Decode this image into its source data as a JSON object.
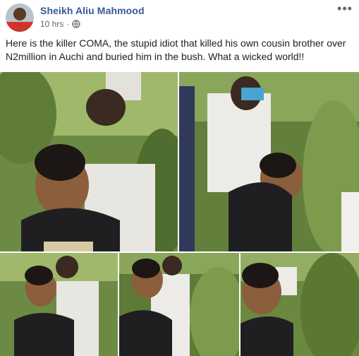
{
  "post": {
    "author": "Sheikh Aliu Mahmood",
    "timestamp": "10 hrs",
    "separator": "·",
    "privacy_icon": "globe-icon",
    "more_icon": "more-options-icon",
    "more_label": "•••",
    "caption": "Here is the killer COMA, the stupid idiot that killed his own cousin brother over N2million in Auchi and buried him in the bush. What a wicked world!!"
  },
  "colors": {
    "author_link": "#385898",
    "meta_text": "#616770",
    "body_text": "#1c1e21"
  },
  "photos": {
    "count": 5
  }
}
